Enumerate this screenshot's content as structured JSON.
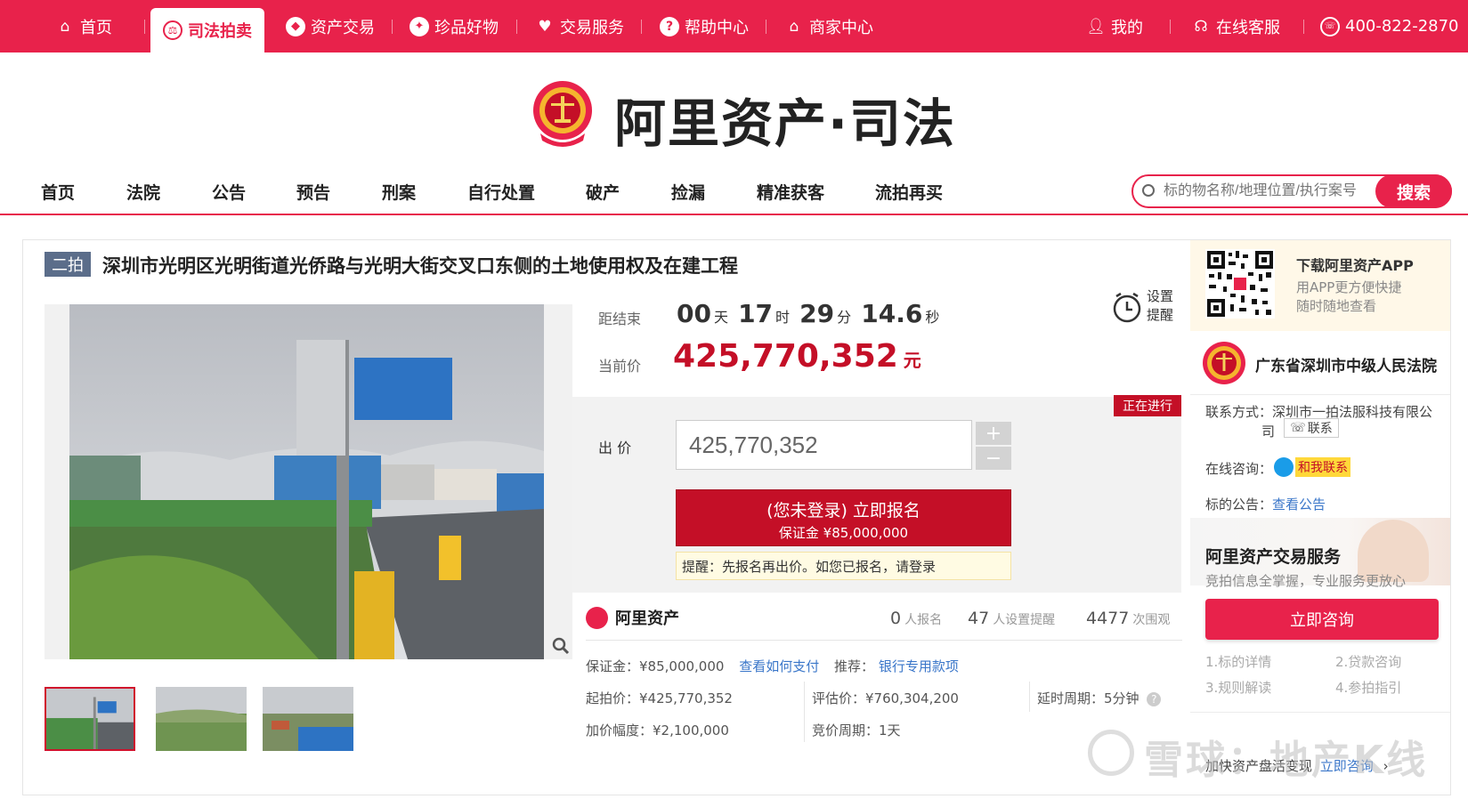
{
  "topnav": {
    "items": [
      {
        "label": "首页",
        "icon": "home-icon"
      },
      {
        "label": "司法拍卖",
        "icon": "court-badge-icon"
      },
      {
        "label": "资产交易",
        "icon": "asset-icon"
      },
      {
        "label": "珍品好物",
        "icon": "gem-icon"
      },
      {
        "label": "交易服务",
        "icon": "heart-icon"
      },
      {
        "label": "帮助中心",
        "icon": "help-icon"
      },
      {
        "label": "商家中心",
        "icon": "shop-icon"
      }
    ],
    "my": "我的",
    "service": "在线客服",
    "phone": "400-822-2870",
    "colors": {
      "brand": "#e8224b",
      "price": "#c40f27",
      "link": "#3a76c9"
    }
  },
  "logo": {
    "text": "阿里资产·司法"
  },
  "mainnav": {
    "items": [
      "首页",
      "法院",
      "公告",
      "预告",
      "刑案",
      "自行处置",
      "破产",
      "捡漏",
      "精准获客",
      "流拍再买"
    ]
  },
  "search": {
    "placeholder": "标的物名称/地理位置/执行案号",
    "button": "搜索"
  },
  "lot": {
    "tag": "二拍",
    "title": "深圳市光明区光明街道光侨路与光明大街交叉口东侧的土地使用权及在建工程"
  },
  "countdown": {
    "label": "距结束",
    "days": "00",
    "days_unit": "天",
    "hours": "17",
    "hours_unit": "时",
    "minutes": "29",
    "minutes_unit": "分",
    "seconds": "14.6",
    "seconds_unit": "秒"
  },
  "price": {
    "label": "当前价",
    "value": "425,770,352",
    "unit": "元"
  },
  "reminder": {
    "line1": "设置",
    "line2": "提醒"
  },
  "bid": {
    "status": "正在进行",
    "label": "出 价",
    "value": "425,770,352",
    "plus": "+",
    "minus": "−",
    "signup_line1": "(您未登录) 立即报名",
    "signup_line2": "保证金 ¥85,000,000",
    "tip": "提醒：先报名再出价。如您已报名，请登录"
  },
  "stats": {
    "brand": "阿里资产",
    "signups": "0",
    "signups_label": "人报名",
    "reminders": "47",
    "reminders_label": "人设置提醒",
    "views": "4477",
    "views_label": "次围观"
  },
  "details": {
    "deposit": "保证金：¥85,000,000",
    "how_pay": "查看如何支付",
    "recommend": "推荐：",
    "bank_link": "银行专用款项",
    "start_price": "起拍价：¥425,770,352",
    "appraisal": "评估价：¥760,304,200",
    "delay": "延时周期：5分钟",
    "increment": "加价幅度：¥2,100,000",
    "cycle": "竞价周期：1天"
  },
  "sidebar": {
    "app_title": "下载阿里资产APP",
    "app_sub1": "用APP更方便快捷",
    "app_sub2": "随时随地查看",
    "court": "广东省深圳市中级人民法院",
    "contact_label": "联系方式：深圳市一拍法服科技有限公",
    "contact_label2": "司",
    "contact_btn": "联系",
    "chat_label": "在线咨询：",
    "chat_btn": "和我联系",
    "notice_label": "标的公告：",
    "notice_link": "查看公告",
    "service_title": "阿里资产交易服务",
    "service_sub": "竞拍信息全掌握，专业服务更放心",
    "consult_btn": "立即咨询",
    "links": [
      "1.标的详情",
      "2.贷款咨询",
      "3.规则解读",
      "4.参拍指引"
    ],
    "fast_text": "加快资产盘活变现",
    "fast_link": "立即咨询"
  },
  "watermark": "雪球：地产K线"
}
